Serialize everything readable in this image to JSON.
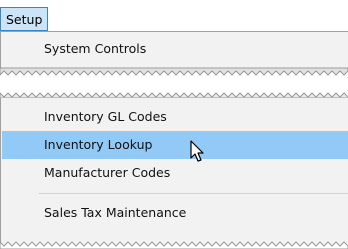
{
  "menubar": {
    "setup_label": "Setup"
  },
  "menu_top": {
    "items": [
      {
        "label": "System Controls"
      }
    ]
  },
  "menu_bottom": {
    "items": [
      {
        "label": "Inventory GL Codes"
      },
      {
        "label": "Inventory Lookup",
        "highlighted": true
      },
      {
        "label": "Manufacturer Codes"
      },
      {
        "label": "Sales Tax Maintenance"
      }
    ]
  },
  "colors": {
    "highlight": "#91c9f7",
    "menubar_active": "#cce4f7",
    "menu_bg": "#f2f2f2"
  }
}
